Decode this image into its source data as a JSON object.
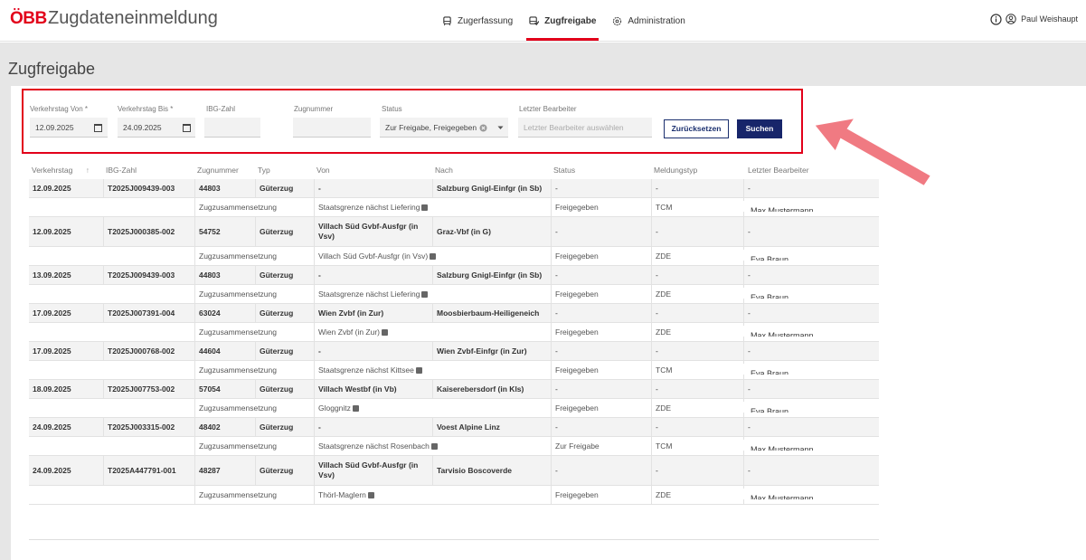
{
  "header": {
    "logo": "ÖBB",
    "app_title": "Zugdateneinmeldung",
    "nav": [
      {
        "label": "Zugerfassung",
        "icon": "train-icon"
      },
      {
        "label": "Zugfreigabe",
        "icon": "train-check-icon"
      },
      {
        "label": "Administration",
        "icon": "gear-icon"
      }
    ],
    "user_name": "Paul Weishaupt"
  },
  "page": {
    "title": "Zugfreigabe"
  },
  "filters": {
    "von_label": "Verkehrstag Von *",
    "von_value": "12.09.2025",
    "bis_label": "Verkehrstag Bis *",
    "bis_value": "24.09.2025",
    "ibg_label": "IBG-Zahl",
    "ibg_value": "",
    "zug_label": "Zugnummer",
    "zug_value": "",
    "status_label": "Status",
    "status_value": "Zur Freigabe, Freigegeben",
    "bearbeiter_label": "Letzter Bearbeiter",
    "bearbeiter_placeholder": "Letzter Bearbeiter auswählen",
    "reset_label": "Zurücksetzen",
    "search_label": "Suchen"
  },
  "table": {
    "headers": [
      "Verkehrstag",
      "IBG-Zahl",
      "Zugnummer",
      "Typ",
      "Von",
      "Nach",
      "Status",
      "Meldungstyp",
      "Letzter Bearbeiter"
    ],
    "sort_indicator": "↑",
    "rows": [
      {
        "date": "12.09.2025",
        "ibg": "T2025J009439-003",
        "zug": "44803",
        "typ": "Güterzug",
        "von": "-",
        "nach": "Salzburg Gnigl-Einfgr (in Sb)",
        "status": "-",
        "meldung": "-",
        "bearbeiter": "-",
        "sub": {
          "label": "Zugzusammensetzung",
          "von": "Staatsgrenze nächst Liefering",
          "status": "Freigegeben",
          "meldung": "TCM",
          "bearbeiter": "Max Mustermann"
        }
      },
      {
        "date": "12.09.2025",
        "ibg": "T2025J000385-002",
        "zug": "54752",
        "typ": "Güterzug",
        "von": "Villach Süd Gvbf-Ausfgr (in Vsv)",
        "nach": "Graz-Vbf (in G)",
        "status": "-",
        "meldung": "-",
        "bearbeiter": "-",
        "sub": {
          "label": "Zugzusammensetzung",
          "von": "Villach Süd Gvbf-Ausfgr (in Vsv)",
          "status": "Freigegeben",
          "meldung": "ZDE",
          "bearbeiter": "Eva Braun"
        }
      },
      {
        "date": "13.09.2025",
        "ibg": "T2025J009439-003",
        "zug": "44803",
        "typ": "Güterzug",
        "von": "-",
        "nach": "Salzburg Gnigl-Einfgr (in Sb)",
        "status": "-",
        "meldung": "-",
        "bearbeiter": "-",
        "sub": {
          "label": "Zugzusammensetzung",
          "von": "Staatsgrenze nächst Liefering",
          "status": "Freigegeben",
          "meldung": "ZDE",
          "bearbeiter": "Eva Braun"
        }
      },
      {
        "date": "17.09.2025",
        "ibg": "T2025J007391-004",
        "zug": "63024",
        "typ": "Güterzug",
        "von": "Wien Zvbf (in Zur)",
        "nach": "Moosbierbaum-Heiligeneich",
        "status": "-",
        "meldung": "-",
        "bearbeiter": "-",
        "sub": {
          "label": "Zugzusammensetzung",
          "von": "Wien Zvbf (in Zur)",
          "status": "Freigegeben",
          "meldung": "ZDE",
          "bearbeiter": "Max Mustermann"
        }
      },
      {
        "date": "17.09.2025",
        "ibg": "T2025J000768-002",
        "zug": "44604",
        "typ": "Güterzug",
        "von": "-",
        "nach": "Wien Zvbf-Einfgr (in Zur)",
        "status": "-",
        "meldung": "-",
        "bearbeiter": "-",
        "sub": {
          "label": "Zugzusammensetzung",
          "von": "Staatsgrenze nächst Kittsee",
          "status": "Freigegeben",
          "meldung": "TCM",
          "bearbeiter": "Eva Braun"
        }
      },
      {
        "date": "18.09.2025",
        "ibg": "T2025J007753-002",
        "zug": "57054",
        "typ": "Güterzug",
        "von": "Villach Westbf (in Vb)",
        "nach": "Kaiserebersdorf (in Kls)",
        "status": "-",
        "meldung": "-",
        "bearbeiter": "-",
        "sub": {
          "label": "Zugzusammensetzung",
          "von": "Gloggnitz",
          "status": "Freigegeben",
          "meldung": "ZDE",
          "bearbeiter": "Eva Braun"
        }
      },
      {
        "date": "24.09.2025",
        "ibg": "T2025J003315-002",
        "zug": "48402",
        "typ": "Güterzug",
        "von": "-",
        "nach": "Voest Alpine Linz",
        "status": "-",
        "meldung": "-",
        "bearbeiter": "-",
        "sub": {
          "label": "Zugzusammensetzung",
          "von": "Staatsgrenze nächst Rosenbach",
          "status": "Zur Freigabe",
          "meldung": "TCM",
          "bearbeiter": "Max Mustermann"
        }
      },
      {
        "date": "24.09.2025",
        "ibg": "T2025A447791-001",
        "zug": "48287",
        "typ": "Güterzug",
        "von": "Villach Süd Gvbf-Ausfgr (in Vsv)",
        "nach": "Tarvisio Boscoverde",
        "status": "-",
        "meldung": "-",
        "bearbeiter": "-",
        "sub": {
          "label": "Zugzusammensetzung",
          "von": "Thörl-Maglern",
          "status": "Freigegeben",
          "meldung": "ZDE",
          "bearbeiter": "Max Mustermann"
        }
      }
    ]
  },
  "colors": {
    "brand_red": "#e2001a",
    "primary_blue": "#17256a",
    "arrow": "#f07a82"
  }
}
